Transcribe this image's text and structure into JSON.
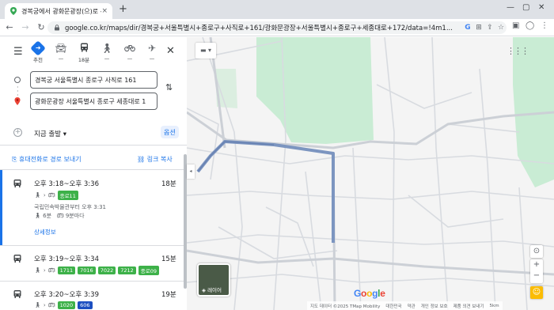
{
  "browser": {
    "tab_title": "경복궁에서 광화문광장(으)로 - Go",
    "tab_close": "×",
    "new_tab": "+",
    "url": "google.co.kr/maps/dir/경복궁+서울특별시+종로구+사직로+161/광화문광장+서울특별시+종로구+세종대로+172/data=!4m1..."
  },
  "directions": {
    "modes": [
      {
        "label": "추천",
        "icon": "recommended-icon",
        "active": true
      },
      {
        "label": "—",
        "icon": "car-icon",
        "active": false
      },
      {
        "label": "18분",
        "icon": "bus-icon",
        "active": false
      },
      {
        "label": "—",
        "icon": "walk-icon",
        "active": false
      },
      {
        "label": "—",
        "icon": "bike-icon",
        "active": false
      },
      {
        "label": "—",
        "icon": "plane-icon",
        "active": false
      }
    ],
    "origin": "경복궁 서울특별시 종로구 사직로 161",
    "destination": "광화문광장 서울특별시 종로구 세종대로 1",
    "depart_label": "지금 출발",
    "options_label": "옵션",
    "send_label": "휴대전화로 경로 보내기",
    "link_label": "링크 복사",
    "routes": [
      {
        "time": "오후 3:18~오후 3:36",
        "duration": "18분",
        "badges": [
          "종로11"
        ],
        "sub1": "국립민속박물관부터 오후 3:31",
        "sub2": "6분",
        "sub3": "9분마다",
        "details": "상세정보"
      },
      {
        "time": "오후 3:19~오후 3:34",
        "duration": "15분",
        "badges": [
          "1711",
          "7016",
          "7022",
          "7212",
          "종로09"
        ]
      },
      {
        "time": "오후 3:20~오후 3:39",
        "duration": "19분",
        "badges": [
          "1020",
          "606"
        ]
      }
    ]
  },
  "map": {
    "layer_label": "레이어",
    "logo": "Google",
    "attribution": [
      "지도 데이터 ©2025 TMap Mobility",
      "대한민국",
      "약관",
      "개인 정보 보호",
      "제품 의견 보내기",
      "5km"
    ],
    "colors": {
      "route": "#7c95c0",
      "park": "#c9ecd4",
      "road": "#d3d6dc"
    }
  }
}
